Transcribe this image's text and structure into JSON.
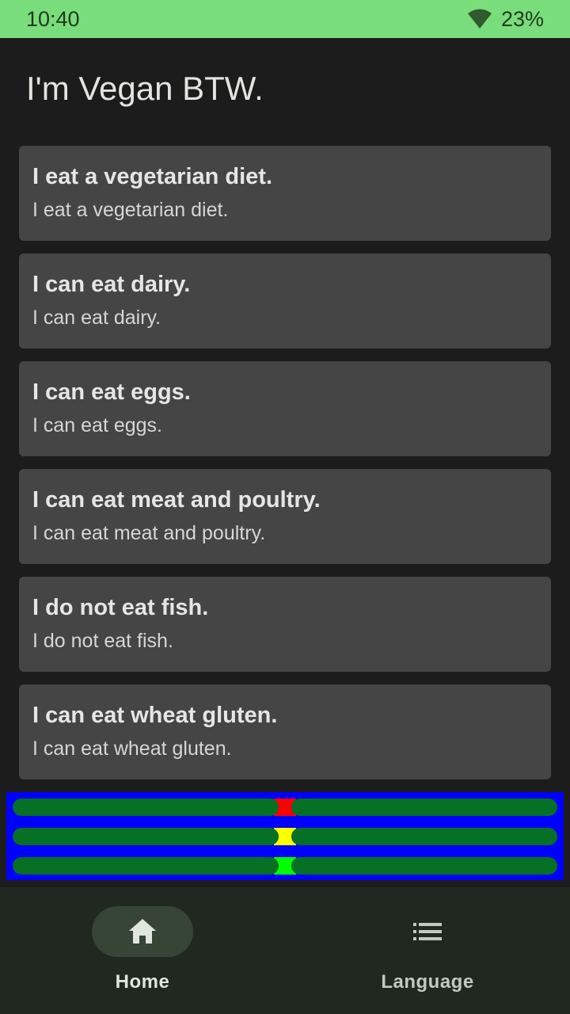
{
  "status_bar": {
    "time": "10:40",
    "battery": "23%",
    "icons": [
      "wifi-icon"
    ]
  },
  "page": {
    "title": "I'm Vegan BTW."
  },
  "cards": [
    {
      "title": "I eat a vegetarian diet.",
      "subtitle": "I eat a vegetarian diet."
    },
    {
      "title": "I can eat dairy.",
      "subtitle": "I can eat dairy."
    },
    {
      "title": "I can eat eggs.",
      "subtitle": "I can eat eggs."
    },
    {
      "title": "I can eat meat and poultry.",
      "subtitle": "I can eat meat and poultry."
    },
    {
      "title": "I do not eat fish.",
      "subtitle": "I do not eat fish."
    },
    {
      "title": "I can eat wheat gluten.",
      "subtitle": "I can eat wheat gluten."
    }
  ],
  "indicator_bars": {
    "panel_color": "#0000ff",
    "track_color": "#067024",
    "rows": [
      {
        "center_color": "#ff0000"
      },
      {
        "center_color": "#ffff00"
      },
      {
        "center_color": "#00ff00"
      }
    ]
  },
  "bottom_nav": {
    "items": [
      {
        "label": "Home",
        "icon": "home-icon",
        "active": true
      },
      {
        "label": "Language",
        "icon": "list-icon",
        "active": false
      }
    ]
  },
  "colors": {
    "status_bar_bg": "#79dd7b",
    "background": "#1b1c1b",
    "card_bg": "#454545",
    "nav_bg": "#202820"
  }
}
